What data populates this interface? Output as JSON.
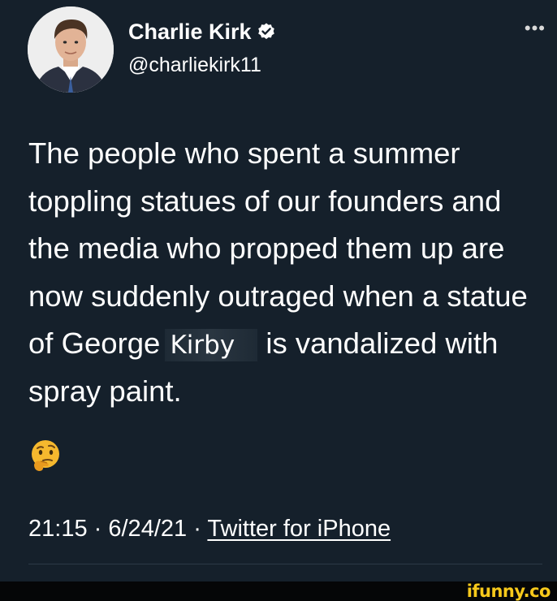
{
  "tweet": {
    "author_name": "Charlie Kirk",
    "handle": "@charliekirk11",
    "more_icon": "•••",
    "text_before": "The people who spent a summer toppling statues of our founders and the media who propped them up are now suddenly outraged when a statue of George ",
    "overlay_word": "Kirby",
    "text_after": " is vandalized with spray paint.",
    "emoji_name": "thinking-face",
    "time": "21:15",
    "date": "6/24/21",
    "source": "Twitter for iPhone",
    "separator": "·"
  },
  "watermark": {
    "text": "ifunny.co",
    "color": "#f7c91b"
  },
  "colors": {
    "background": "#15202b",
    "verified": "#ffffff"
  }
}
